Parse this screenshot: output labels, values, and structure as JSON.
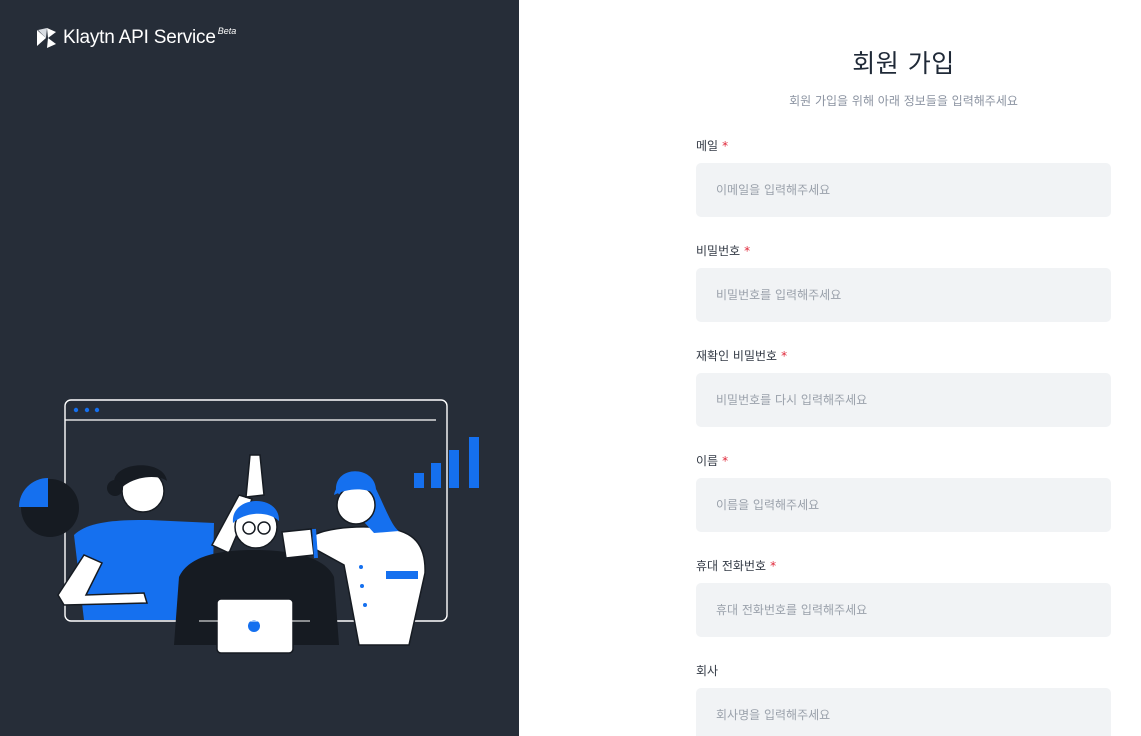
{
  "brand": {
    "name": "Klaytn API Service",
    "badge": "Beta"
  },
  "signup": {
    "title": "회원 가입",
    "subtitle": "회원 가입을 위해 아래 정보들을 입력해주세요",
    "required_mark": "*",
    "fields": [
      {
        "label": "메일",
        "required": true,
        "placeholder": "이메일을 입력해주세요",
        "value": ""
      },
      {
        "label": "비밀번호",
        "required": true,
        "placeholder": "비밀번호를 입력해주세요",
        "value": ""
      },
      {
        "label": "재확인 비밀번호",
        "required": true,
        "placeholder": "비밀번호를 다시 입력해주세요",
        "value": ""
      },
      {
        "label": "이름",
        "required": true,
        "placeholder": "이름을 입력해주세요",
        "value": ""
      },
      {
        "label": "휴대 전화번호",
        "required": true,
        "placeholder": "휴대 전화번호를 입력해주세요",
        "value": ""
      },
      {
        "label": "회사",
        "required": false,
        "placeholder": "회사명을 입력해주세요",
        "value": ""
      }
    ]
  },
  "colors": {
    "panel_dark": "#262d38",
    "accent_blue": "#1570ef",
    "required_red": "#e0283a",
    "input_bg": "#f1f3f5"
  },
  "illustration": {
    "icon": "team-high-five-illustration"
  }
}
